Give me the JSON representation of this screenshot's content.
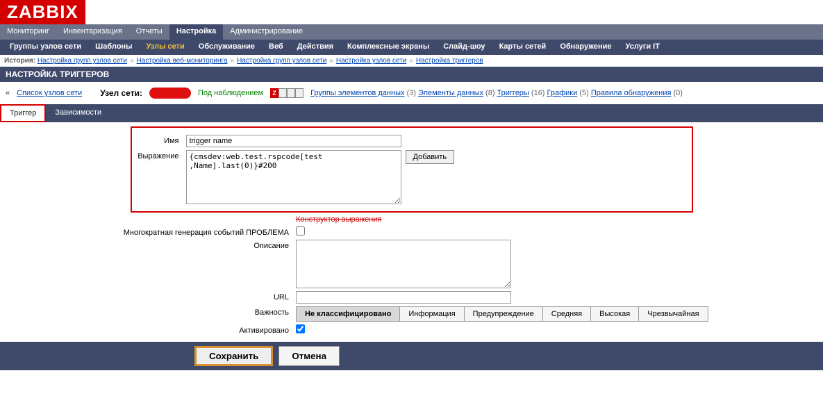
{
  "logo": "ZABBIX",
  "mainMenu": [
    "Мониторинг",
    "Инвентаризация",
    "Отчеты",
    "Настройка",
    "Администрирование"
  ],
  "mainMenuActive": 3,
  "subMenu": [
    "Группы узлов сети",
    "Шаблоны",
    "Узлы сети",
    "Обслуживание",
    "Веб",
    "Действия",
    "Комплексные экраны",
    "Слайд-шоу",
    "Карты сетей",
    "Обнаружение",
    "Услуги IT"
  ],
  "subMenuActive": 2,
  "history": {
    "label": "История:",
    "items": [
      "Настройка групп узлов сети",
      "Настройка веб-мониторинга",
      "Настройка групп узлов сети",
      "Настройка узлов сети",
      "Настройка триггеров"
    ]
  },
  "pageTitle": "НАСТРОЙКА ТРИГГЕРОВ",
  "hostBar": {
    "laquo": "«",
    "hostListLink": "Список узлов сети",
    "hostLabel": "Узел сети:",
    "monitored": "Под наблюдением",
    "nav": [
      {
        "label": "Группы элементов данных",
        "count": "(3)"
      },
      {
        "label": "Элементы данных",
        "count": "(8)"
      },
      {
        "label": "Триггеры",
        "count": "(16)"
      },
      {
        "label": "Графики",
        "count": "(5)"
      },
      {
        "label": "Правила обнаружения",
        "count": "(0)"
      }
    ]
  },
  "tabs": {
    "trigger": "Триггер",
    "dependencies": "Зависимости"
  },
  "form": {
    "nameLabel": "Имя",
    "nameValue": "trigger name",
    "exprLabel": "Выражение",
    "exprValue": "{cmsdev:web.test.rspcode[test ,Name].last(0)}#200",
    "addBtn": "Добавить",
    "constructor": "Конструктор выражения",
    "multiLabel": "Многократная генерация событий ПРОБЛЕМА",
    "descLabel": "Описание",
    "descValue": "",
    "urlLabel": "URL",
    "urlValue": "",
    "severityLabel": "Важность",
    "severities": [
      "Не классифицировано",
      "Информация",
      "Предупреждение",
      "Средняя",
      "Высокая",
      "Чрезвычайная"
    ],
    "severitySel": 0,
    "enabledLabel": "Активировано"
  },
  "footer": {
    "save": "Сохранить",
    "cancel": "Отмена"
  }
}
